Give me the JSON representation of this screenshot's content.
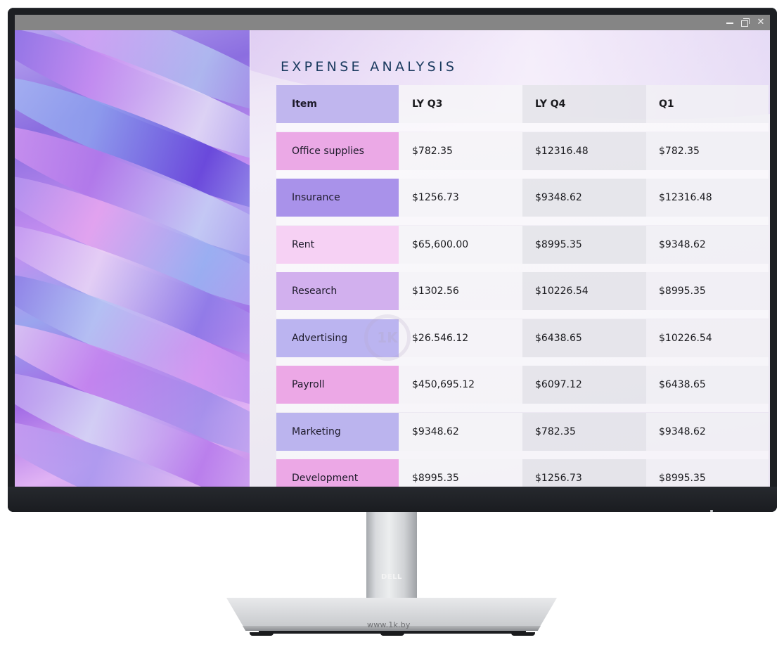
{
  "window": {
    "controls": [
      {
        "name": "minimize",
        "icon": "minimize-icon"
      },
      {
        "name": "restore",
        "icon": "restore-icon"
      },
      {
        "name": "close",
        "icon": "close-icon"
      }
    ]
  },
  "content": {
    "title": "EXPENSE ANALYSIS",
    "table": {
      "headers": [
        "Item",
        "LY Q3",
        "LY Q4",
        "Q1"
      ],
      "rows": [
        {
          "item": "Office supplies",
          "ly_q3": "$782.35",
          "ly_q4": "$12316.48",
          "q1": "$782.35",
          "color": "#eba9e6"
        },
        {
          "item": "Insurance",
          "ly_q3": "$1256.73",
          "ly_q4": "$9348.62",
          "q1": "$12316.48",
          "color": "#a992ea"
        },
        {
          "item": "Rent",
          "ly_q3": "$65,600.00",
          "ly_q4": "$8995.35",
          "q1": "$9348.62",
          "color": "#f6d1f4"
        },
        {
          "item": "Research",
          "ly_q3": "$1302.56",
          "ly_q4": "$10226.54",
          "q1": "$8995.35",
          "color": "#d2b0ee"
        },
        {
          "item": "Advertising",
          "ly_q3": "$26.546.12",
          "ly_q4": "$6438.65",
          "q1": "$10226.54",
          "color": "#bbb4f0"
        },
        {
          "item": "Payroll",
          "ly_q3": "$450,695.12",
          "ly_q4": "$6097.12",
          "q1": "$6438.65",
          "color": "#eca8e6"
        },
        {
          "item": "Marketing",
          "ly_q3": "$9348.62",
          "ly_q4": "$782.35",
          "q1": "$9348.62",
          "color": "#bbb4ee"
        },
        {
          "item": "Development",
          "ly_q3": "$8995.35",
          "ly_q4": "$1256.73",
          "q1": "$8995.35",
          "color": "#eca8e6"
        }
      ],
      "header_color": "#c0b6ee"
    }
  },
  "watermark": "1K",
  "hardware": {
    "brand_logo": "DELL",
    "site_mark": "www.1k.by"
  }
}
